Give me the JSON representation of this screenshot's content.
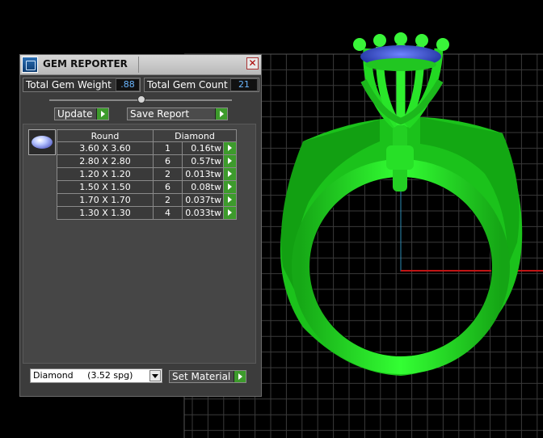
{
  "panel": {
    "title": "GEM REPORTER",
    "total_gem_weight_label": "Total Gem Weight",
    "total_gem_weight_value": ".88",
    "total_gem_count_label": "Total Gem Count",
    "total_gem_count_value": "21",
    "update_label": "Update",
    "save_report_label": "Save Report",
    "table": {
      "headers": [
        "Round",
        "Diamond"
      ],
      "rows": [
        {
          "size": "3.60 X 3.60",
          "qty": "1",
          "weight": "0.16tw"
        },
        {
          "size": "2.80 X 2.80",
          "qty": "6",
          "weight": "0.57tw"
        },
        {
          "size": "1.20 X 1.20",
          "qty": "2",
          "weight": "0.013tw"
        },
        {
          "size": "1.50 X 1.50",
          "qty": "6",
          "weight": "0.08tw"
        },
        {
          "size": "1.70 X 1.70",
          "qty": "2",
          "weight": "0.037tw"
        },
        {
          "size": "1.30 X 1.30",
          "qty": "4",
          "weight": "0.033tw"
        }
      ]
    },
    "material_select_value": "Diamond     (3.52 spg)",
    "set_material_label": "Set Material"
  },
  "icons": {
    "app": "gem-reporter-icon",
    "close": "close-icon",
    "gem": "round-gem-icon",
    "arrow": "green-arrow-icon"
  },
  "colors": {
    "ring": "#22dd22",
    "stone": "#2a4bd0",
    "grid": "#3a3a3a",
    "axis_red": "#c01515",
    "axis_blue": "#2c8bb5",
    "action_green": "#3d9b2c",
    "value_blue": "#6ab7ff"
  }
}
